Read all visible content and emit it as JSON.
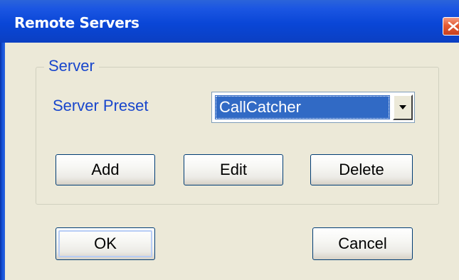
{
  "window": {
    "title": "Remote Servers"
  },
  "icons": {
    "close": "close-icon",
    "dropdown": "chevron-down-icon"
  },
  "server_group": {
    "legend": "Server",
    "preset_label": "Server Preset",
    "preset_selected": "CallCatcher",
    "add_label": "Add",
    "edit_label": "Edit",
    "delete_label": "Delete"
  },
  "footer": {
    "ok_label": "OK",
    "cancel_label": "Cancel"
  },
  "colors": {
    "titlebar": "#0a46d7",
    "dialog_bg": "#ece9d8",
    "label_text": "#1846cc",
    "selection": "#316ac5",
    "close_button": "#e35a34"
  }
}
